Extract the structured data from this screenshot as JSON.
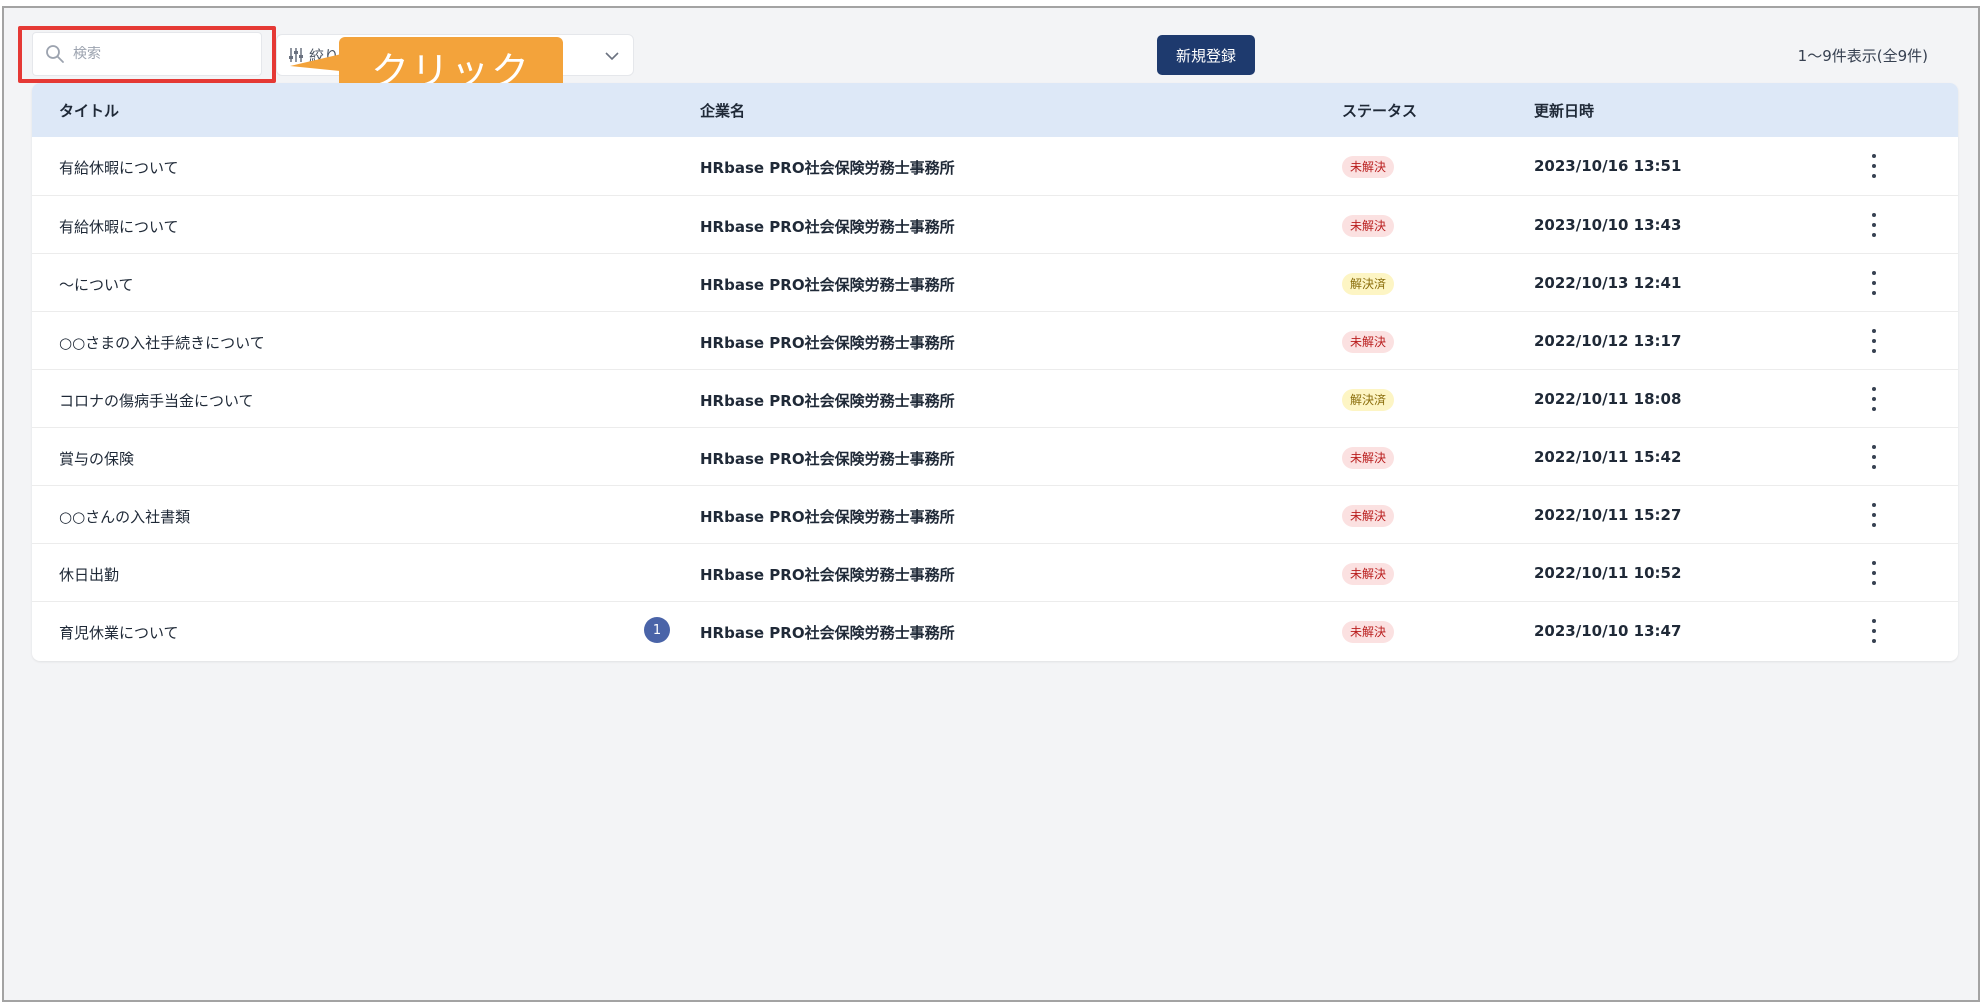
{
  "toolbar": {
    "search_placeholder": "検索",
    "filter_label": "絞り",
    "new_button_label": "新規登録",
    "result_count": "1～9件表示(全9件)"
  },
  "callout": {
    "text": "クリック"
  },
  "table": {
    "headers": {
      "title": "タイトル",
      "company": "企業名",
      "status": "ステータス",
      "updated": "更新日時"
    },
    "rows": [
      {
        "title": "有給休暇について",
        "company": "HRbase PRO社会保険労務士事務所",
        "status": "未解決",
        "updated": "2023/10/16 13:51"
      },
      {
        "title": "有給休暇について",
        "company": "HRbase PRO社会保険労務士事務所",
        "status": "未解決",
        "updated": "2023/10/10 13:43"
      },
      {
        "title": "～について",
        "company": "HRbase PRO社会保険労務士事務所",
        "status": "解決済",
        "updated": "2022/10/13 12:41"
      },
      {
        "title": "○○さまの入社手続きについて",
        "company": "HRbase PRO社会保険労務士事務所",
        "status": "未解決",
        "updated": "2022/10/12 13:17"
      },
      {
        "title": "コロナの傷病手当金について",
        "company": "HRbase PRO社会保険労務士事務所",
        "status": "解決済",
        "updated": "2022/10/11 18:08"
      },
      {
        "title": "賞与の保険",
        "company": "HRbase PRO社会保険労務士事務所",
        "status": "未解決",
        "updated": "2022/10/11 15:42"
      },
      {
        "title": "○○さんの入社書類",
        "company": "HRbase PRO社会保険労務士事務所",
        "status": "未解決",
        "updated": "2022/10/11 15:27"
      },
      {
        "title": "休日出勤",
        "company": "HRbase PRO社会保険労務士事務所",
        "status": "未解決",
        "updated": "2022/10/11 10:52"
      },
      {
        "title": "育児休業について",
        "company": "HRbase PRO社会保険労務士事務所",
        "status": "未解決",
        "updated": "2023/10/10 13:47",
        "unread": "1"
      }
    ]
  },
  "colors": {
    "accent": "#1e3a6e",
    "highlight": "#e53935",
    "callout": "#f3a33b",
    "header_bg": "#dde8f7",
    "unresolved_bg": "#fbe1e1",
    "resolved_bg": "#fdf5c4"
  }
}
